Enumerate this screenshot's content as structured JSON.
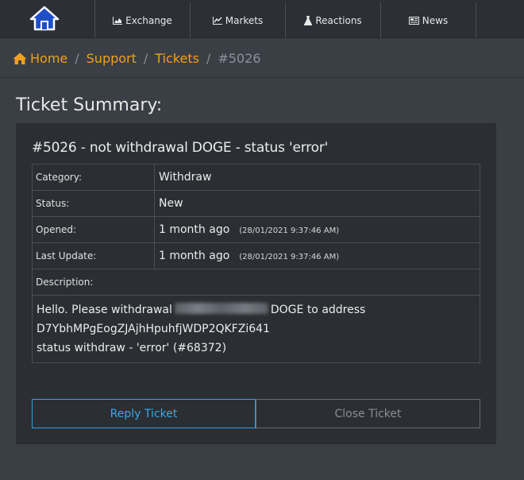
{
  "nav": {
    "items": [
      {
        "label": "Exchange",
        "icon": "area-chart-icon"
      },
      {
        "label": "Markets",
        "icon": "line-chart-icon"
      },
      {
        "label": "Reactions",
        "icon": "flask-icon"
      },
      {
        "label": "News",
        "icon": "newspaper-icon"
      }
    ]
  },
  "breadcrumb": {
    "home": "Home",
    "support": "Support",
    "tickets": "Tickets",
    "current": "#5026",
    "separator": "/"
  },
  "page": {
    "title": "Ticket Summary:"
  },
  "ticket": {
    "heading": "#5026 - not withdrawal DOGE - status 'error'",
    "rows": [
      {
        "label": "Category:",
        "value": "Withdraw",
        "sub": ""
      },
      {
        "label": "Status:",
        "value": "New",
        "sub": ""
      },
      {
        "label": "Opened:",
        "value": "1 month ago",
        "sub": "(28/01/2021 9:37:46 AM)"
      },
      {
        "label": "Last Update:",
        "value": "1 month ago",
        "sub": "(28/01/2021 9:37:46 AM)"
      }
    ],
    "description_label": "Description:",
    "description": {
      "line1_before": "Hello. Please withdrawal",
      "line1_after": "DOGE to address",
      "line2": "D7YbhMPgEogZJAjhHpuhfjWDP2QKFZi641",
      "line3": "status withdraw - 'error' (#68372)"
    }
  },
  "actions": {
    "reply": "Reply Ticket",
    "close": "Close Ticket"
  },
  "colors": {
    "accent_orange": "#f0a020",
    "accent_blue": "#3aa8ea",
    "panel_bg": "#2b2e33",
    "page_bg": "#3a3e45"
  }
}
